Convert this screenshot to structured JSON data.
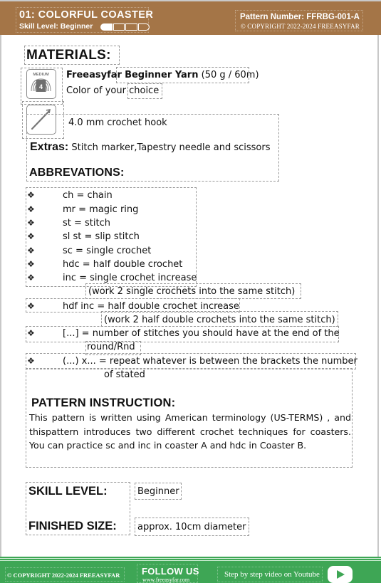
{
  "header": {
    "title": "01: COLORFUL COASTER",
    "skill_level_label": "Skill Level: Beginner",
    "skill_meter": {
      "filled": 1,
      "total": 4
    },
    "pattern_number": "Pattern Number: FFRBG-001-A",
    "copyright": "© COPYRIGHT 2022-2024 FREEASYFAR",
    "background_color": "#a47547"
  },
  "materials": {
    "title": "MATERIALS:",
    "yarn": {
      "icon": "yarn-weight-medium-4-icon",
      "icon_label": "MEDIUM",
      "icon_number": "4",
      "brand": "Freeasyfar",
      "name": "Beginner Yarn",
      "amount": "(50 g / 60m)",
      "color_prefix": "Color of your",
      "color_suffix": "choice"
    },
    "hook": {
      "icon": "crochet-hook-icon",
      "text": "4.0 mm crochet hook"
    },
    "extras_label": "Extras:",
    "extras_text": "Stitch marker,Tapestry needle and scissors"
  },
  "abbreviations": {
    "title": "ABBREVATIONS:",
    "bullet": "❖",
    "items": [
      {
        "text": "ch = chain"
      },
      {
        "text": "mr = magic ring"
      },
      {
        "text": "st = stitch"
      },
      {
        "text": "sl st = slip stitch"
      },
      {
        "text": "sc = single crochet"
      },
      {
        "text": "hdc = half double crochet"
      },
      {
        "text": "inc = single crochet increase",
        "continuation": "(work 2 single crochets into the same   stitch)"
      },
      {
        "text": "hdf inc = half double crochet increase",
        "continuation": "(work 2 half double crochets into the same stitch)"
      },
      {
        "text": "[...] = number of stitches you should have at the end of the",
        "continuation": "round/Rnd"
      },
      {
        "text": "(...) x... = repeat whatever is between the brackets the number",
        "continuation": "of stated"
      }
    ]
  },
  "pattern_instruction": {
    "title": "PATTERN INSTRUCTION:",
    "body": "This pattern is written using American terminology (US-TERMS) , and thispattern introduces two different crochet techniques for coasters. You can practice sc and inc in coaster A and hdc in Coaster B."
  },
  "skill_level": {
    "label": "SKILL LEVEL:",
    "value": "Beginner"
  },
  "finished_size": {
    "label": "FINISHED SIZE:",
    "value": "approx. 10cm diameter"
  },
  "footer": {
    "copyright": "© COPYRIGHT 2022-2024 FREEASYFAR",
    "follow_label": "FOLLOW US",
    "website": "www.freeasyfar.com",
    "video_label": "Step by step video on Youtube",
    "video_icon": "youtube-play-icon",
    "background_color": "#3ea655"
  }
}
